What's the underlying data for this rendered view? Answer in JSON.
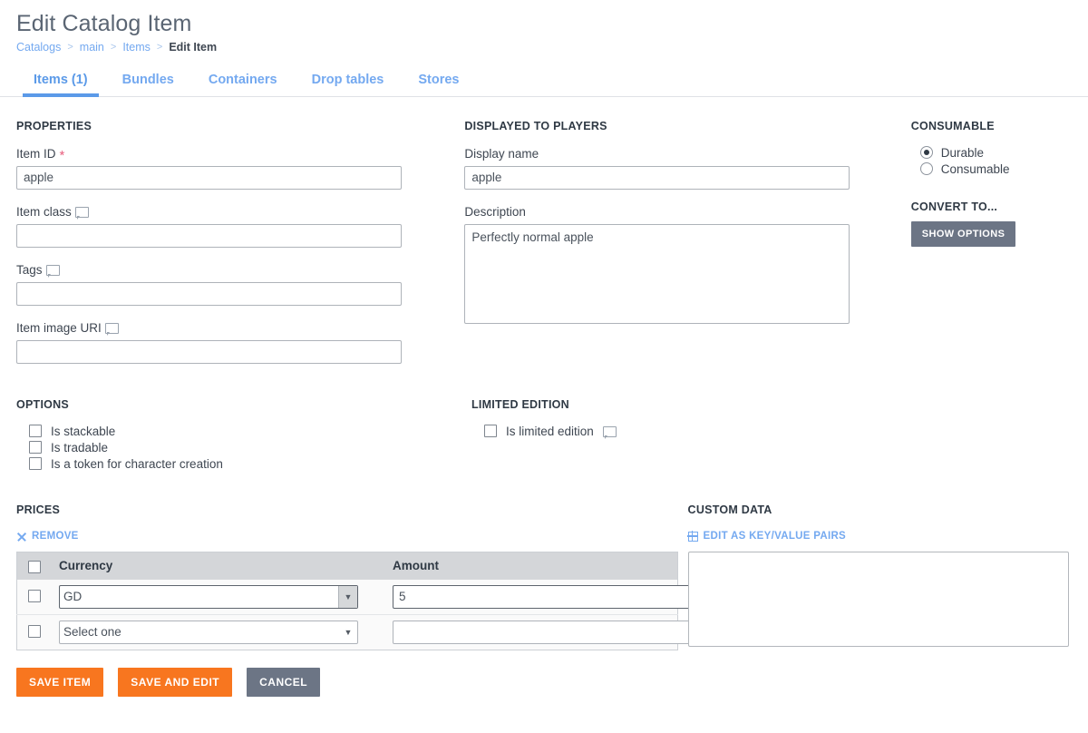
{
  "header": {
    "title": "Edit Catalog Item",
    "breadcrumb": [
      {
        "label": "Catalogs",
        "current": false
      },
      {
        "label": "main",
        "current": false
      },
      {
        "label": "Items",
        "current": false
      },
      {
        "label": "Edit Item",
        "current": true
      }
    ],
    "separator": ">"
  },
  "tabs": [
    {
      "label": "Items (1)",
      "active": true
    },
    {
      "label": "Bundles",
      "active": false
    },
    {
      "label": "Containers",
      "active": false
    },
    {
      "label": "Drop tables",
      "active": false
    },
    {
      "label": "Stores",
      "active": false
    }
  ],
  "properties": {
    "section_title": "PROPERTIES",
    "item_id": {
      "label": "Item ID",
      "value": "apple",
      "required_marker": "*",
      "placeholder": ""
    },
    "item_class": {
      "label": "Item class",
      "value": "",
      "placeholder": "",
      "has_tooltip": true
    },
    "tags": {
      "label": "Tags",
      "value": "",
      "placeholder": "",
      "has_tooltip": true
    },
    "item_image_uri": {
      "label": "Item image URI",
      "value": "",
      "placeholder": "",
      "has_tooltip": true
    }
  },
  "displayed_to_players": {
    "section_title": "DISPLAYED TO PLAYERS",
    "display_name": {
      "label": "Display name",
      "value": "apple",
      "placeholder": ""
    },
    "description": {
      "label": "Description",
      "value": "Perfectly normal apple",
      "placeholder": ""
    }
  },
  "consumable": {
    "section_title": "CONSUMABLE",
    "options": [
      {
        "label": "Durable",
        "selected": true
      },
      {
        "label": "Consumable",
        "selected": false
      }
    ],
    "convert_to_title": "CONVERT TO...",
    "show_options_label": "SHOW OPTIONS"
  },
  "options": {
    "section_title": "OPTIONS",
    "checkboxes": [
      {
        "label": "Is stackable",
        "checked": false
      },
      {
        "label": "Is tradable",
        "checked": false
      },
      {
        "label": "Is a token for character creation",
        "checked": false
      }
    ]
  },
  "limited_edition": {
    "section_title": "LIMITED EDITION",
    "checkbox": {
      "label": "Is limited edition",
      "checked": false,
      "has_tooltip": true
    }
  },
  "prices": {
    "section_title": "PRICES",
    "remove_label": "REMOVE",
    "remove_icon": "close-x-icon",
    "columns": [
      "Currency",
      "Amount"
    ],
    "rows": [
      {
        "selected": false,
        "currency": "GD",
        "amount": "5",
        "focused": true
      },
      {
        "selected": false,
        "currency": "Select one",
        "amount": "",
        "focused": false
      }
    ],
    "currency_options": [
      "Select one",
      "GD"
    ]
  },
  "custom_data": {
    "section_title": "CUSTOM DATA",
    "edit_link_label": "EDIT AS KEY/VALUE PAIRS",
    "edit_link_icon": "grid-icon",
    "value": "",
    "placeholder": ""
  },
  "footer": {
    "buttons": [
      {
        "label": "SAVE ITEM",
        "style": "orange"
      },
      {
        "label": "SAVE AND EDIT",
        "style": "orange"
      },
      {
        "label": "CANCEL",
        "style": "grey"
      }
    ]
  },
  "colors": {
    "accent_blue": "#5b9ae8",
    "link_blue": "#74a9f0",
    "orange": "#f8761f",
    "grey_button": "#6c7585",
    "required_red": "#e8607f",
    "table_header": "#d4d6d9"
  }
}
